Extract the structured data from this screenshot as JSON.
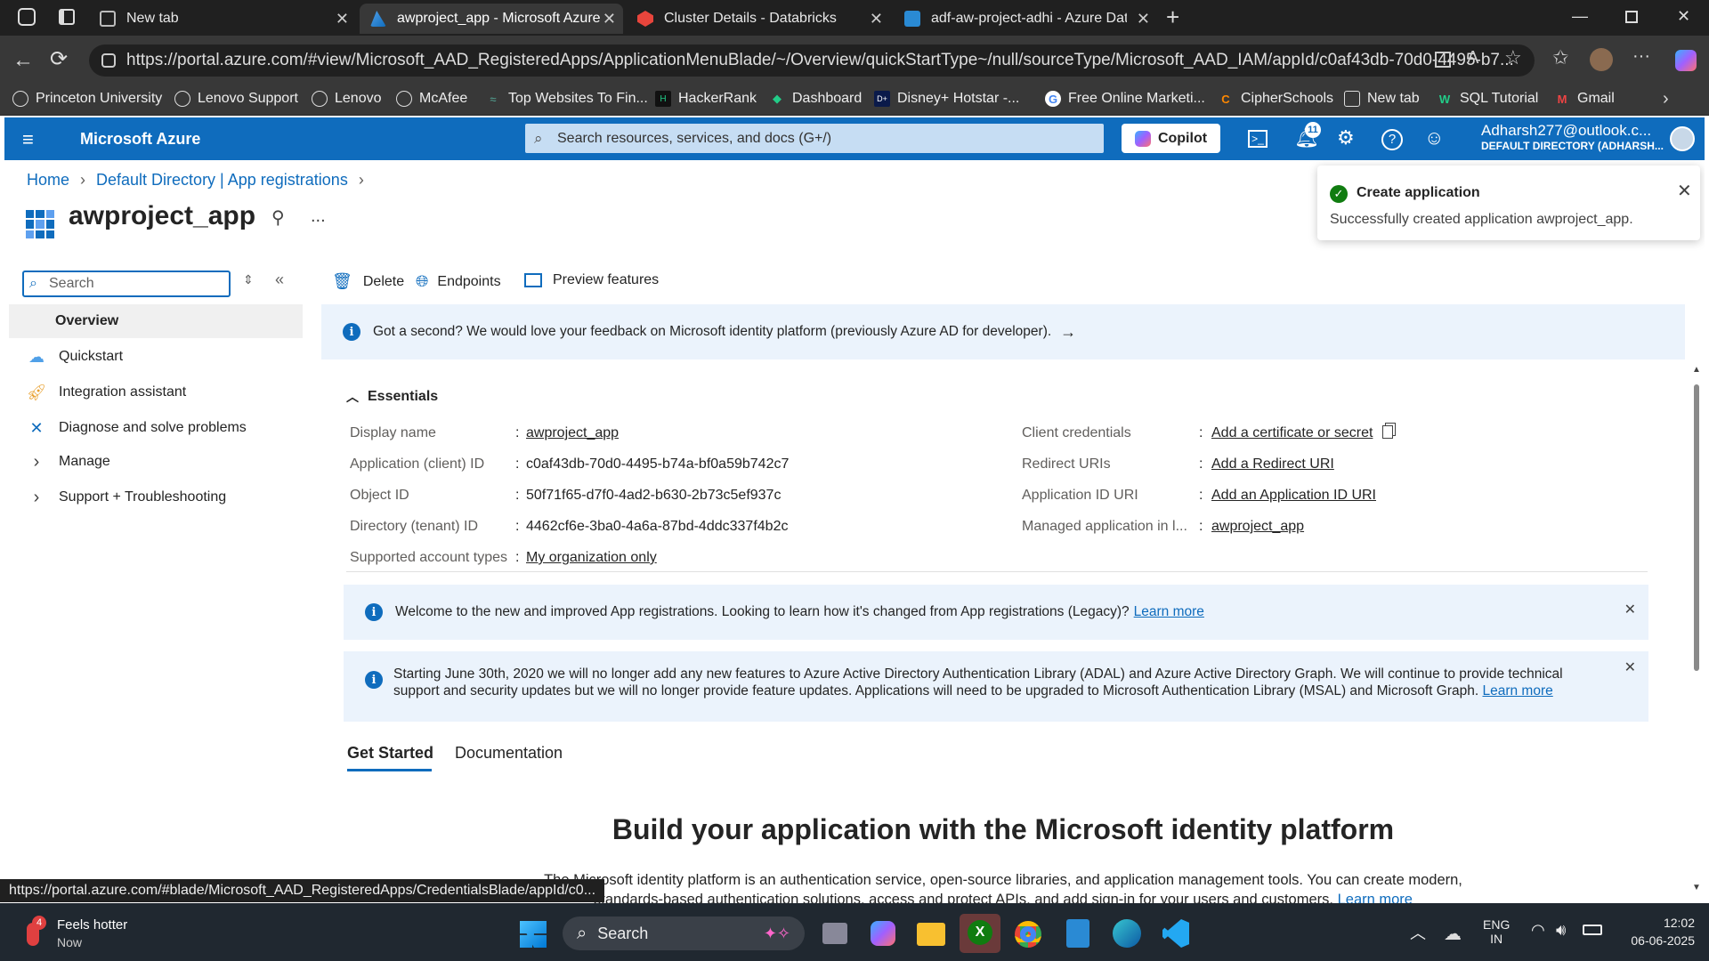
{
  "browser": {
    "tabs": [
      {
        "title": "New tab"
      },
      {
        "title": "awproject_app - Microsoft Azure"
      },
      {
        "title": "Cluster Details - Databricks"
      },
      {
        "title": "adf-aw-project-adhi - Azure Data"
      }
    ],
    "url": "https://portal.azure.com/#view/Microsoft_AAD_RegisteredApps/ApplicationMenuBlade/~/Overview/quickStartType~/null/sourceType/Microsoft_AAD_IAM/appId/c0af43db-70d0-4495-b7...",
    "bookmarks": [
      "Princeton University",
      "Lenovo Support",
      "Lenovo",
      "McAfee",
      "Top Websites To Fin...",
      "HackerRank",
      "Dashboard",
      "Disney+ Hotstar -...",
      "Free Online Marketi...",
      "CipherSchools",
      "New tab",
      "SQL Tutorial",
      "Gmail"
    ]
  },
  "azure": {
    "brand": "Microsoft Azure",
    "search_placeholder": "Search resources, services, and docs (G+/)",
    "copilot": "Copilot",
    "notifications_count": "11",
    "user_email": "Adharsh277@outlook.c...",
    "user_directory": "DEFAULT DIRECTORY (ADHARSH..."
  },
  "breadcrumb": {
    "home": "Home",
    "second": "Default Directory | App registrations"
  },
  "page": {
    "title": "awproject_app",
    "more": "..."
  },
  "toast": {
    "title": "Create application",
    "message": "Successfully created application awproject_app."
  },
  "sidebar": {
    "search_placeholder": "Search",
    "items": [
      {
        "label": "Overview"
      },
      {
        "label": "Quickstart"
      },
      {
        "label": "Integration assistant"
      },
      {
        "label": "Diagnose and solve problems"
      },
      {
        "label": "Manage"
      },
      {
        "label": "Support + Troubleshooting"
      }
    ]
  },
  "toolbar": {
    "delete": "Delete",
    "endpoints": "Endpoints",
    "preview": "Preview features"
  },
  "feedback": "Got a second? We would love your feedback on Microsoft identity platform (previously Azure AD for developer).",
  "essentials": {
    "heading": "Essentials",
    "left": [
      {
        "label": "Display name",
        "value": "awproject_app"
      },
      {
        "label": "Application (client) ID",
        "value": "c0af43db-70d0-4495-b74a-bf0a59b742c7"
      },
      {
        "label": "Object ID",
        "value": "50f71f65-d7f0-4ad2-b630-2b73c5ef937c"
      },
      {
        "label": "Directory (tenant) ID",
        "value": "4462cf6e-3ba0-4a6a-87bd-4ddc337f4b2c"
      },
      {
        "label": "Supported account types",
        "value": "My organization only"
      }
    ],
    "right": [
      {
        "label": "Client credentials",
        "value": "Add a certificate or secret"
      },
      {
        "label": "Redirect URIs",
        "value": "Add a Redirect URI"
      },
      {
        "label": "Application ID URI",
        "value": "Add an Application ID URI"
      },
      {
        "label": "Managed application in l...",
        "value": "awproject_app"
      }
    ]
  },
  "banner1": {
    "text": "Welcome to the new and improved App registrations. Looking to learn how it's changed from App registrations (Legacy)?",
    "link": "Learn more"
  },
  "banner2": {
    "text": "Starting June 30th, 2020 we will no longer add any new features to Azure Active Directory Authentication Library (ADAL) and Azure Active Directory Graph. We will continue to provide technical support and security updates but we will no longer provide feature updates. Applications will need to be upgraded to Microsoft Authentication Library (MSAL) and Microsoft Graph.",
    "link": "Learn more"
  },
  "tabs": [
    "Get Started",
    "Documentation"
  ],
  "build": {
    "heading": "Build your application with the Microsoft identity platform",
    "line1": "The Microsoft identity platform is an authentication service, open-source libraries, and application management tools. You can create modern,",
    "line2": "standards-based authentication solutions, access and protect APIs, and add sign-in for your users and customers.",
    "link": "Learn more"
  },
  "status_url": "https://portal.azure.com/#blade/Microsoft_AAD_RegisteredApps/CredentialsBlade/appId/c0...",
  "taskbar": {
    "weather_title": "Feels hotter",
    "weather_sub": "Now",
    "weather_badge": "4",
    "search": "Search",
    "lang1": "ENG",
    "lang2": "IN",
    "time": "12:02",
    "date": "06-06-2025"
  }
}
